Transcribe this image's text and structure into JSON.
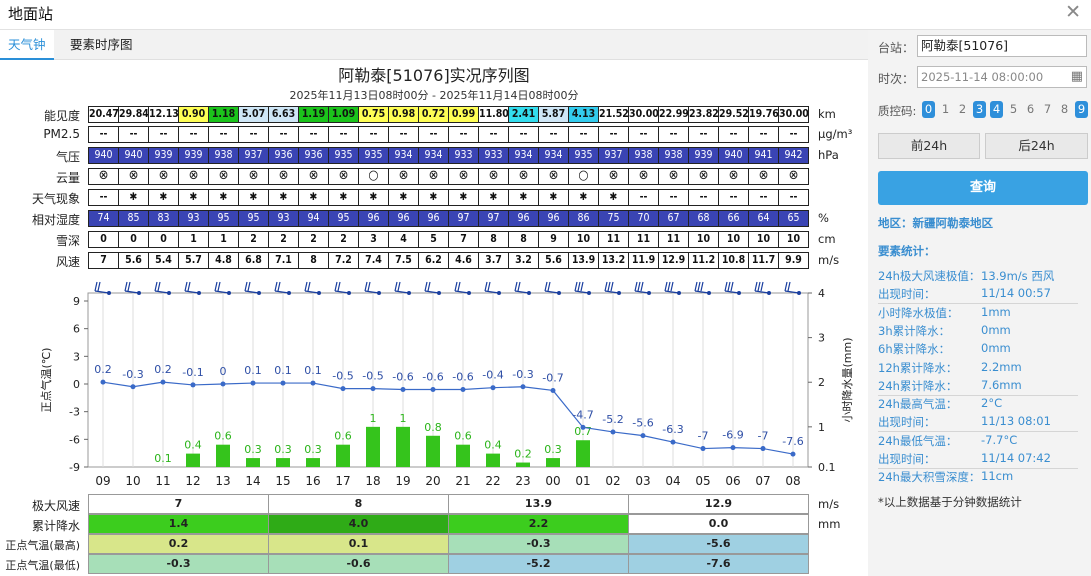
{
  "window": {
    "title": "地面站"
  },
  "tabs": [
    "天气钟",
    "要素时序图"
  ],
  "chart_title": "阿勒泰[51076]实况序列图",
  "chart_subtitle": "2025年11月13日08时00分 - 2025年11月14日08时00分",
  "hours": [
    "09",
    "10",
    "11",
    "12",
    "13",
    "14",
    "15",
    "16",
    "17",
    "18",
    "19",
    "20",
    "21",
    "22",
    "23",
    "00",
    "01",
    "02",
    "03",
    "04",
    "05",
    "06",
    "07",
    "08"
  ],
  "rows": {
    "visibility": {
      "label": "能见度",
      "unit": "km",
      "values": [
        "20.47",
        "29.84",
        "12.13",
        "0.90",
        "1.18",
        "5.07",
        "6.63",
        "1.19",
        "1.09",
        "0.75",
        "0.98",
        "0.72",
        "0.99",
        "11.80",
        "2.41",
        "5.87",
        "4.13",
        "21.52",
        "30.00",
        "22.99",
        "23.82",
        "29.52",
        "19.76",
        "30.00"
      ],
      "colors": [
        "#ffffff",
        "#ffffff",
        "#ffffff",
        "#ffff55",
        "#1bc41b",
        "#cfe7f7",
        "#cfe7f7",
        "#1bc41b",
        "#1bc41b",
        "#ffff55",
        "#ffff55",
        "#ffff55",
        "#ffff55",
        "#ffffff",
        "#33ddee",
        "#cfe7f7",
        "#33ccee",
        "#ffffff",
        "#ffffff",
        "#ffffff",
        "#ffffff",
        "#ffffff",
        "#ffffff",
        "#ffffff"
      ]
    },
    "pm25": {
      "label": "PM2.5",
      "unit": "µg/m³",
      "values": [
        "--",
        "--",
        "--",
        "--",
        "--",
        "--",
        "--",
        "--",
        "--",
        "--",
        "--",
        "--",
        "--",
        "--",
        "--",
        "--",
        "--",
        "--",
        "--",
        "--",
        "--",
        "--",
        "--",
        "--"
      ]
    },
    "pressure": {
      "label": "气压",
      "unit": "hPa",
      "values": [
        "940",
        "940",
        "939",
        "939",
        "938",
        "937",
        "936",
        "936",
        "935",
        "935",
        "934",
        "934",
        "933",
        "933",
        "934",
        "934",
        "935",
        "937",
        "938",
        "938",
        "939",
        "940",
        "941",
        "942"
      ]
    },
    "cloud": {
      "label": "云量",
      "unit": "",
      "values": [
        "⊗",
        "⊗",
        "⊗",
        "⊗",
        "⊗",
        "⊗",
        "⊗",
        "⊗",
        "⊗",
        "○",
        "⊗",
        "⊗",
        "⊗",
        "⊗",
        "⊗",
        "⊗",
        "○",
        "⊗",
        "⊗",
        "⊗",
        "⊗",
        "⊗",
        "⊗",
        "⊗"
      ]
    },
    "weather": {
      "label": "天气现象",
      "unit": "",
      "values": [
        "--",
        "✱",
        "✱",
        "✱",
        "✱",
        "✱",
        "✱",
        "✱",
        "✱",
        "✱",
        "✱",
        "✱",
        "✱",
        "✱",
        "✱",
        "✱",
        "✱",
        "✱",
        "--",
        "--",
        "--",
        "--",
        "--",
        "--"
      ]
    },
    "humidity": {
      "label": "相对湿度",
      "unit": "%",
      "values": [
        "74",
        "85",
        "83",
        "93",
        "95",
        "95",
        "93",
        "94",
        "95",
        "96",
        "96",
        "96",
        "97",
        "97",
        "96",
        "96",
        "86",
        "75",
        "70",
        "67",
        "68",
        "66",
        "64",
        "65"
      ]
    },
    "snow": {
      "label": "雪深",
      "unit": "cm",
      "values": [
        "0",
        "0",
        "0",
        "1",
        "1",
        "2",
        "2",
        "2",
        "2",
        "3",
        "4",
        "5",
        "7",
        "8",
        "8",
        "9",
        "10",
        "11",
        "11",
        "11",
        "10",
        "10",
        "10",
        "10"
      ]
    },
    "wind": {
      "label": "风速",
      "unit": "m/s",
      "values": [
        "7",
        "5.6",
        "5.4",
        "5.7",
        "4.8",
        "6.8",
        "7.1",
        "8",
        "7.2",
        "7.4",
        "7.5",
        "6.2",
        "4.6",
        "3.7",
        "3.2",
        "5.6",
        "13.9",
        "13.2",
        "11.9",
        "12.9",
        "11.2",
        "10.8",
        "11.7",
        "9.9"
      ]
    }
  },
  "chart_data": {
    "type": "line+bar",
    "x": [
      "09",
      "10",
      "11",
      "12",
      "13",
      "14",
      "15",
      "16",
      "17",
      "18",
      "19",
      "20",
      "21",
      "22",
      "23",
      "00",
      "01",
      "02",
      "03",
      "04",
      "05",
      "06",
      "07",
      "08"
    ],
    "y_left": {
      "label": "正点气温(℃)",
      "ticks": [
        9,
        6,
        3,
        0,
        -3,
        -6,
        -9
      ],
      "range": [
        -9,
        9
      ]
    },
    "y_right": {
      "label": "小时降水量(mm)",
      "ticks": [
        "4",
        "3",
        "2",
        "1",
        "0.1"
      ]
    },
    "temperature": [
      0.2,
      -0.3,
      0.2,
      -0.1,
      0,
      0.1,
      0.1,
      0.1,
      -0.5,
      -0.5,
      -0.6,
      -0.6,
      -0.6,
      -0.4,
      -0.3,
      -0.7,
      -4.7,
      -5.2,
      -5.6,
      -6.3,
      -7,
      -6.9,
      -7,
      -7.6
    ],
    "precip": [
      null,
      null,
      0.1,
      0.4,
      0.6,
      0.3,
      0.3,
      0.3,
      0.6,
      1,
      1,
      0.8,
      0.6,
      0.4,
      0.2,
      0.3,
      0.7,
      null,
      null,
      null,
      null,
      null,
      null,
      null
    ]
  },
  "summary": {
    "rows": [
      {
        "label": "极大风速",
        "unit": "m/s",
        "cells": [
          {
            "v": "7",
            "bg": "#ffffff"
          },
          {
            "v": "8",
            "bg": "#ffffff"
          },
          {
            "v": "13.9",
            "bg": "#ffffff"
          },
          {
            "v": "12.9",
            "bg": "#ffffff"
          }
        ]
      },
      {
        "label": "累计降水",
        "unit": "mm",
        "cells": [
          {
            "v": "1.4",
            "bg": "#3ccd1e"
          },
          {
            "v": "4.0",
            "bg": "#2fab17"
          },
          {
            "v": "2.2",
            "bg": "#3ccd1e"
          },
          {
            "v": "0.0",
            "bg": "#ffffff"
          }
        ]
      },
      {
        "label": "正点气温(最高)",
        "unit": "",
        "cells": [
          {
            "v": "0.2",
            "bg": "#d8e68a"
          },
          {
            "v": "0.1",
            "bg": "#d8e68a"
          },
          {
            "v": "-0.3",
            "bg": "#a7dfb8"
          },
          {
            "v": "-5.6",
            "bg": "#9fd0e2"
          }
        ]
      },
      {
        "label": "正点气温(最低)",
        "unit": "",
        "cells": [
          {
            "v": "-0.3",
            "bg": "#a7dfb8"
          },
          {
            "v": "-0.6",
            "bg": "#a7dfb8"
          },
          {
            "v": "-5.2",
            "bg": "#9fd0e2"
          },
          {
            "v": "-7.6",
            "bg": "#9fd0e2"
          }
        ]
      }
    ]
  },
  "side": {
    "station_label": "台站：",
    "station_value": "阿勒泰[51076]",
    "time_label": "时次：",
    "time_value": "2025-11-14 08:00:00",
    "qc_label": "质控码:",
    "qc_codes": [
      "0",
      "1",
      "2",
      "3",
      "4",
      "5",
      "6",
      "7",
      "8",
      "9"
    ],
    "prev_btn": "前24h",
    "next_btn": "后24h",
    "query_btn": "查询",
    "region": "地区：新疆阿勒泰地区",
    "stats_title": "要素统计：",
    "stats": [
      {
        "l": "24h极大风速极值：",
        "v": "13.9m/s 西风"
      },
      {
        "l": "出现时间：",
        "v": "11/14 00:57"
      },
      {
        "l": "小时降水极值：",
        "v": "1mm"
      },
      {
        "l": "3h累计降水：",
        "v": "0mm"
      },
      {
        "l": "6h累计降水：",
        "v": "0mm"
      },
      {
        "l": "12h累计降水：",
        "v": "2.2mm"
      },
      {
        "l": "24h累计降水：",
        "v": "7.6mm"
      },
      {
        "l": "24h最高气温：",
        "v": "2°C"
      },
      {
        "l": "出现时间：",
        "v": "11/13 08:01"
      },
      {
        "l": "24h最低气温：",
        "v": "-7.7°C"
      },
      {
        "l": "出现时间：",
        "v": "11/14 07:42"
      },
      {
        "l": "24h最大积雪深度：",
        "v": "11cm"
      }
    ],
    "note": "*以上数据基于分钟数据统计"
  }
}
